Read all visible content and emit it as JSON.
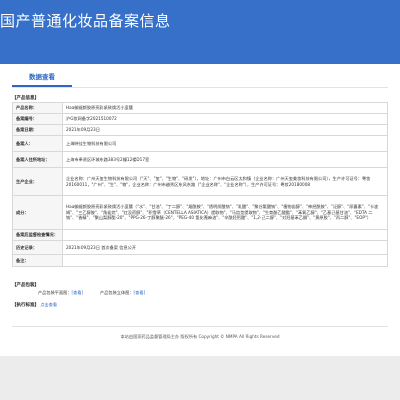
{
  "banner": {
    "title": "国产普通化妆品备案信息"
  },
  "tabs": [
    {
      "label": "数据查看"
    }
  ],
  "info_section": {
    "heading": "【产品信息】",
    "rows": [
      {
        "label": "产品名称：",
        "value": "Haa御缇颜胶原亮彩紧致焕活小蛮腰"
      },
      {
        "label": "备案编号：",
        "value": "沪G妆网备字2021510072"
      },
      {
        "label": "备案日期：",
        "value": "2021年09月23日"
      },
      {
        "label": "备案人：",
        "value": "上海映佳生物科技有限公司"
      },
      {
        "label": "备案人住所地址：",
        "value": "上海市奉贤区环城东路383号2幢12楼D17室"
      },
      {
        "label": "生产企业：",
        "value": "企业名称：广州天玺生物科技有限公司（\"天\"、\"玺\"、\"生物\"、\"研发\"），地址：广州市白云区太和镇（企业名称：广州天玺美妆科技有限公司），生产许可证号：粤妆20160011，\"广州\"、\"生\"、\"物\"，企业名称：广州市越秀区东风东路（\"企业名称\"、\"企业名称\"），生产许可证号：粤妆20180008"
      },
      {
        "label": "成分：",
        "value": "Haa御缇颜胶原亮彩紧致焕活小蛮腰（\"水\"、\"甘油\"、\"丁二醇\"、\"烟酰胺\"、\"透明质酸钠\"、\"乳酸\"、\"聚谷氨酸钠\"、\"植物甾醇\"、\"神经酰胺\"、\"泛醇\"、\"尿囊素\"、\"卡波姆\"、\"三乙醇胺\"、\"角鲨烷\"、\"红没药醇\"、\"积雪草（CENTELLA ASIATICA）提取物\"、\"马齿苋提取物\"、\"生育酚乙酸酯\"、\"苯氧乙醇\"、\"乙基己基甘油\"、\"EDTA 二钠\"、\"香精\"、\"聚山梨醇酯-20\"、\"PPG-26-丁醇聚醚-26\"、\"PEG-40 氢化蓖麻油\"、\"辛酰羟肟酸\"、\"1,2-己二醇\"、\"对羟基苯乙酮\"、\"黄原胶\"、\"丙二醇\"、\"EOP\"）"
      },
      {
        "label": "备案后监督检查情况：",
        "value": ""
      },
      {
        "label": "历史记录：",
        "value": "2021年09月23日 首次备案 信息公开"
      },
      {
        "label": "备注：",
        "value": ""
      }
    ]
  },
  "package_section": {
    "heading": "【产品包装】",
    "line1_prefix": "产品包装平面图：",
    "line1_link": "[查看]",
    "line2_prefix": "产品包装立体图：",
    "line2_link": "[查看]"
  },
  "exec_section": {
    "heading": "【执行标准】",
    "link": "点击查看"
  },
  "footer": {
    "text": "本站由国家药品监督管理局主办 版权所有 Copyright © NMPA All Rights Reserved"
  }
}
